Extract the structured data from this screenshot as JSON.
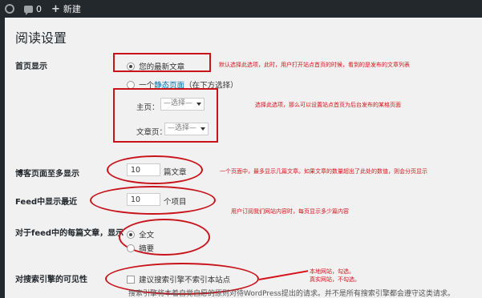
{
  "adminbar": {
    "comments_count": "0",
    "new_label": "新建"
  },
  "page_title": "阅读设置",
  "front_page": {
    "label": "首页显示",
    "option_latest": "您的最新文章",
    "option_static_prefix": "一个",
    "option_static_link": "静态页面",
    "option_static_suffix": "（在下方选择）",
    "homepage_label": "主页：",
    "homepage_select": "—选择—",
    "postspage_label": "文章页：",
    "postspage_select": "—选择—"
  },
  "posts_per_page": {
    "label": "博客页面至多显示",
    "value": "10",
    "unit": "篇文章"
  },
  "feed_items": {
    "label": "Feed中显示最近",
    "value": "10",
    "unit": "个项目"
  },
  "feed_content": {
    "label": "对于feed中的每篇文章，显示",
    "option_full": "全文",
    "option_summary": "摘要"
  },
  "search_visibility": {
    "label": "对搜索引擎的可见性",
    "checkbox_label": "建议搜索引擎不索引本站点",
    "description": "搜索引擎将本着自觉自愿的原则对待WordPress提出的请求。并不是所有搜索引擎都会遵守这类请求。"
  },
  "annotations": {
    "latest": "默认选择此选项，此时，用户打开站点首页的时候，看到的是发布的文章列表",
    "static": "选择此选项，那么可以设置站点首页为后台发布的某格页面",
    "posts": "一个页面中，最多显示几篇文章。如果文章的数量超出了此处的数值，则会分页显示",
    "feed": "用户订阅我们网站内容时，每页显示多少篇内容",
    "search_line1": "本地网站，勾选。",
    "search_line2": "真实网站，不勾选。"
  },
  "colors": {
    "annotation": "#d6141c",
    "link": "#0073aa",
    "adminbar": "#23282d"
  }
}
